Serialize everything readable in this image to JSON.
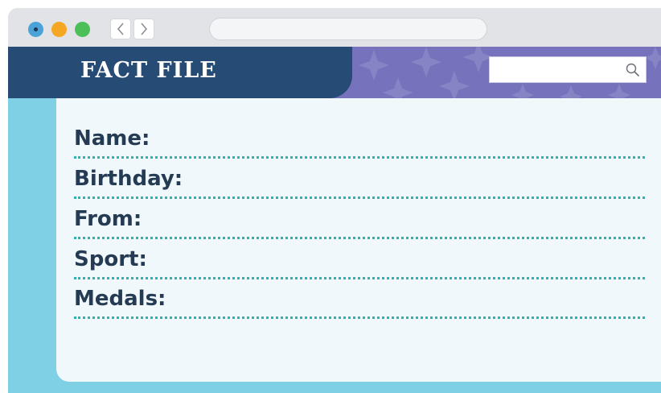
{
  "window": {
    "controls": [
      "close",
      "minimize",
      "maximize"
    ],
    "control_colors": {
      "close": "#4aa3d8",
      "minimize": "#f5a623",
      "maximize": "#4cbf58"
    },
    "nav_back_icon": "chevron-left-icon",
    "nav_forward_icon": "chevron-right-icon",
    "address_bar": {
      "value": ""
    }
  },
  "header": {
    "title": "FACT FILE",
    "search": {
      "value": "",
      "icon": "search-icon"
    },
    "colors": {
      "title_tab": "#264b75",
      "band": "#7673bc"
    }
  },
  "fact_file": {
    "fields": [
      {
        "label": "Name:",
        "value": ""
      },
      {
        "label": "Birthday:",
        "value": ""
      },
      {
        "label": "From:",
        "value": ""
      },
      {
        "label": "Sport:",
        "value": ""
      },
      {
        "label": "Medals:",
        "value": ""
      }
    ],
    "colors": {
      "background": "#7fcfe5",
      "card": "#f1f8fb",
      "rule": "#2bb3b0"
    }
  }
}
